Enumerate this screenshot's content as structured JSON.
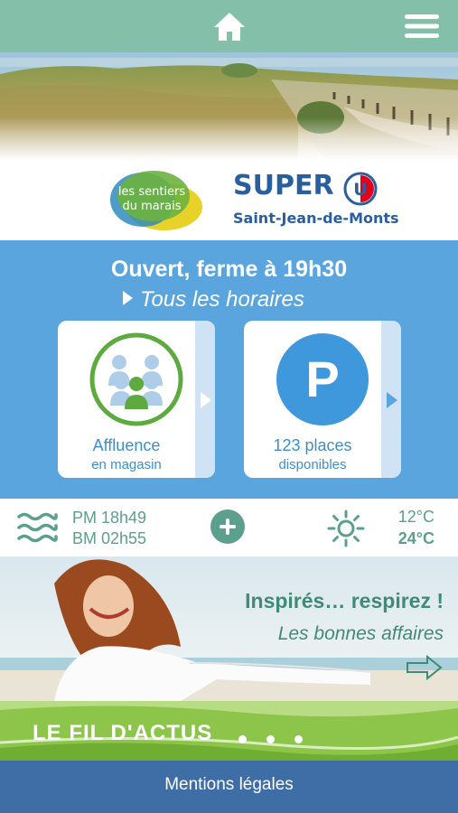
{
  "header": {
    "home_icon": "home-icon",
    "menu_icon": "hamburger-menu-icon",
    "bar_color": "#84bfaa"
  },
  "logos": {
    "partner_line1": "les sentiers",
    "partner_line2": "du marais",
    "store_brand": "SUPER",
    "store_brand_mark": "U",
    "store_city": "Saint-Jean-de-Monts"
  },
  "hours": {
    "status": "Ouvert, ferme à 19h30",
    "link": "Tous les horaires"
  },
  "cards": [
    {
      "line1": "Affluence",
      "line2": "en magasin",
      "icon": "crowd-icon"
    },
    {
      "line1": "123 places",
      "line2": "disponibles",
      "icon": "parking-icon",
      "glyph": "P"
    }
  ],
  "weather": {
    "tide_high": "PM 18h49",
    "tide_low": "BM 02h55",
    "temp_min": "12°C",
    "temp_max": "24°C",
    "tide_icon": "waves-icon",
    "weather_icon": "sun-icon",
    "more_icon": "plus-icon"
  },
  "promo": {
    "title": "Inspirés… respirez !",
    "subtitle": "Les bonnes affaires",
    "arrow_icon": "arrow-right-icon"
  },
  "news": {
    "title": "LE FIL D'ACTUS"
  },
  "footer": {
    "link": "Mentions légales"
  },
  "colors": {
    "teal": "#84bfaa",
    "blue": "#5aa5de",
    "dark_blue": "#3e6ea5",
    "green": "#8cc54a",
    "brand_blue": "#2a5f9e"
  }
}
